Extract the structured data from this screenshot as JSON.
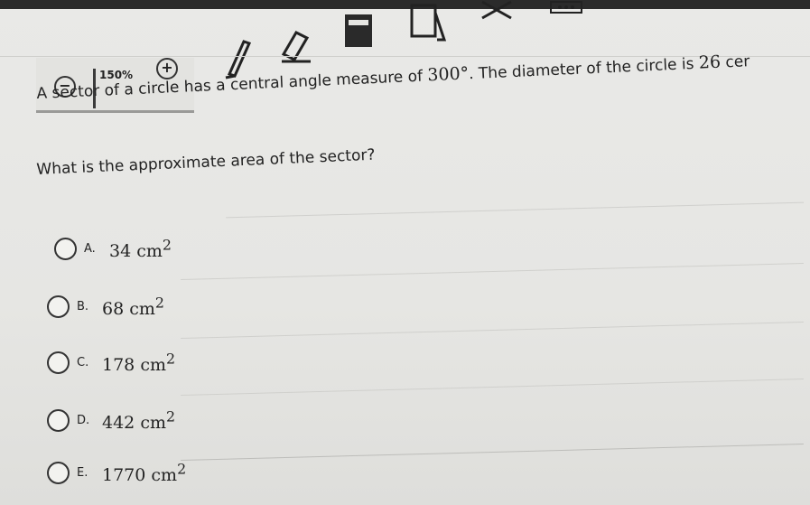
{
  "toolbar": {
    "zoom_level": "150%",
    "zoom_out_icon": "minus-circle-icon",
    "zoom_in_icon": "plus-circle-icon"
  },
  "question": {
    "text_before": "A sector of a circle has a central angle measure of ",
    "angle": "300°",
    "text_after": ". The diameter of the circle is ",
    "diameter": "26",
    "text_end": " cer",
    "prompt": "What is the approximate area of the sector?"
  },
  "choices": [
    {
      "letter": "A.",
      "value": "34",
      "unit": "cm",
      "exp": "2"
    },
    {
      "letter": "B.",
      "value": "68",
      "unit": "cm",
      "exp": "2"
    },
    {
      "letter": "C.",
      "value": "178",
      "unit": "cm",
      "exp": "2"
    },
    {
      "letter": "D.",
      "value": "442",
      "unit": "cm",
      "exp": "2"
    },
    {
      "letter": "E.",
      "value": "1770",
      "unit": "cm",
      "exp": "2"
    }
  ]
}
